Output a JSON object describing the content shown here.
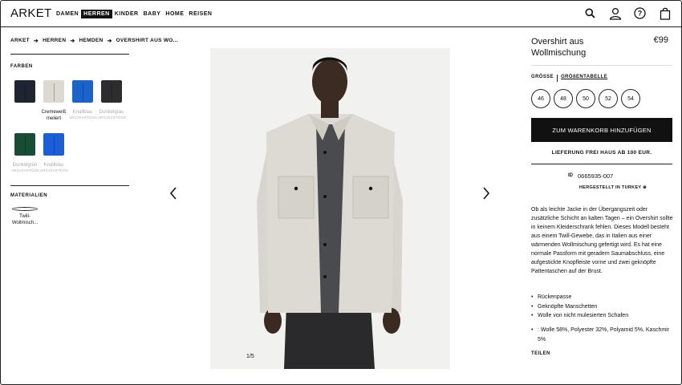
{
  "header": {
    "logo": "ARKET",
    "nav": [
      "DAMEN",
      "HERREN",
      "KINDER",
      "BABY",
      "HOME",
      "REISEN"
    ],
    "active_nav": "HERREN",
    "icons": [
      "search-icon",
      "account-icon",
      "help-icon",
      "bag-icon"
    ]
  },
  "breadcrumb": [
    "ARKET",
    "HERREN",
    "HEMDEN",
    "OVERSHIRT AUS WO..."
  ],
  "filters": {
    "colors_label": "FARBEN",
    "swatches": [
      {
        "name": "",
        "sub": "",
        "color": "#1f2433"
      },
      {
        "name": "Cremeweiß meliert",
        "sub": "",
        "color": "#dcd9d2"
      },
      {
        "name": "Knallblau",
        "sub": "ARCHIVSTÜCK",
        "color": "#1b63c8"
      },
      {
        "name": "Dunkelgrau",
        "sub": "ARCHIVSTÜCK",
        "color": "#2d2d2f"
      },
      {
        "name": "Dunkelgrün",
        "sub": "ARCHIVSTÜCK",
        "color": "#174d35"
      },
      {
        "name": "Knallblau",
        "sub": "ARCHIVSTÜCK",
        "color": "#1d5ed6"
      }
    ],
    "materials_label": "MATERIALIEN",
    "material": "Twill-Wollmisch..."
  },
  "gallery": {
    "counter": "1/5",
    "prev": "‹",
    "next": "›"
  },
  "product": {
    "title": "Overshirt aus Wollmischung",
    "price": "€99",
    "size_label": "GRÖSSE",
    "size_guide": "GRÖßENTABELLE",
    "sizes": [
      "46",
      "48",
      "50",
      "52",
      "54"
    ],
    "cta": "ZUM WARENKORB HINZUFÜGEN",
    "shipping": "LIEFERUNG FREI HAUS AB 100 EUR.",
    "article_key": "ID",
    "article_id": "0665935-007",
    "origin": "HERGESTELLT IN TURKEY ⊕",
    "description": "Ob als leichte Jacke in der Übergangszeit oder zusätzliche Schicht an kalten Tagen – ein Overshirt sollte in keinem Kleiderschrank fehlen. Dieses Modell besteht aus einem Twill-Gewebe, das in Italien aus einer wärmenden Wollmischung gefertigt wird. Es hat eine normale Passform mit geradem Saumabschluss, eine aufgestickte Knopfleiste vorne und zwei geknöpfte Pattentaschen auf der Brust.",
    "features": [
      "Rückenpasse",
      "Geknöpfte Manschetten",
      "Wolle von nicht mulesierten Schafen"
    ],
    "composition": ": Wolle 58%, Polyester 32%, Polyamid 5%, Kaschmir 5%",
    "share": "TEILEN"
  }
}
